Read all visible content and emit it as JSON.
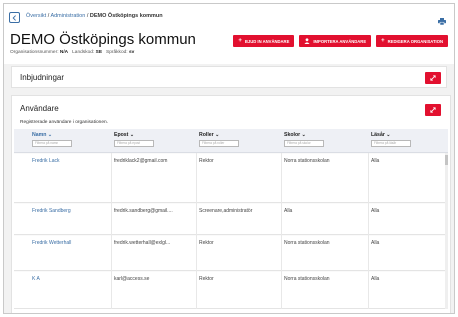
{
  "breadcrumb": {
    "link1": "Översikt",
    "sep": " / ",
    "link2": "Administration",
    "current": "DEMO Östköpings kommun"
  },
  "organization": {
    "title": "DEMO Östköpings kommun",
    "orgnr_label": "Organisationsnummer:",
    "orgnr_value": "N/A",
    "country_label": "Landskod:",
    "country_value": "SE",
    "lang_label": "Språkkod:",
    "lang_value": "sv"
  },
  "actions": {
    "invite": "BJUD IN ANVÄNDARE",
    "import": "IMPORTERA ANVÄNDARE",
    "edit": "REDIGERA ORGANISATION"
  },
  "invitations": {
    "title": "Inbjudningar"
  },
  "users": {
    "title": "Användare",
    "subtitle": "Registrerade användare i organisationen.",
    "columns": [
      {
        "label": "Namn",
        "sort_icon": "chevron-down",
        "filter_placeholder": "Filtrera på namn"
      },
      {
        "label": "Epost",
        "sort_icon": "chevron-down",
        "filter_placeholder": "Filtrera på epost"
      },
      {
        "label": "Roller",
        "sort_icon": "chevron-down",
        "filter_placeholder": "Filtrera på roller"
      },
      {
        "label": "Skolor",
        "sort_icon": "chevron-down",
        "filter_placeholder": "Filtrera på skolor"
      },
      {
        "label": "Läsår",
        "sort_icon": "chevron-down",
        "filter_placeholder": "Filtrera på läsår"
      }
    ],
    "rows": [
      {
        "name": "Fredrik Lack",
        "email": "fredriklack2@gmail.com",
        "role": "Rektor",
        "school": "Norra stationsskolan",
        "year": "Alla"
      },
      {
        "name": "Fredrik Sandberg",
        "email": "fredrik.sandberg@gmail....",
        "role": "Screenare,administratör",
        "school": "Alla",
        "year": "Alla"
      },
      {
        "name": "Fredrik Wetterhall",
        "email": "fredrik.wetterhall@exlgl...",
        "role": "Rektor",
        "school": "Norra stationsskolan",
        "year": "Alla"
      },
      {
        "name": "K A",
        "email": "karl@access.se",
        "role": "Rektor",
        "school": "Norra stationsskolan",
        "year": "Alla"
      }
    ]
  },
  "colors": {
    "accent": "#e2102f",
    "link": "#3a6ea5"
  }
}
